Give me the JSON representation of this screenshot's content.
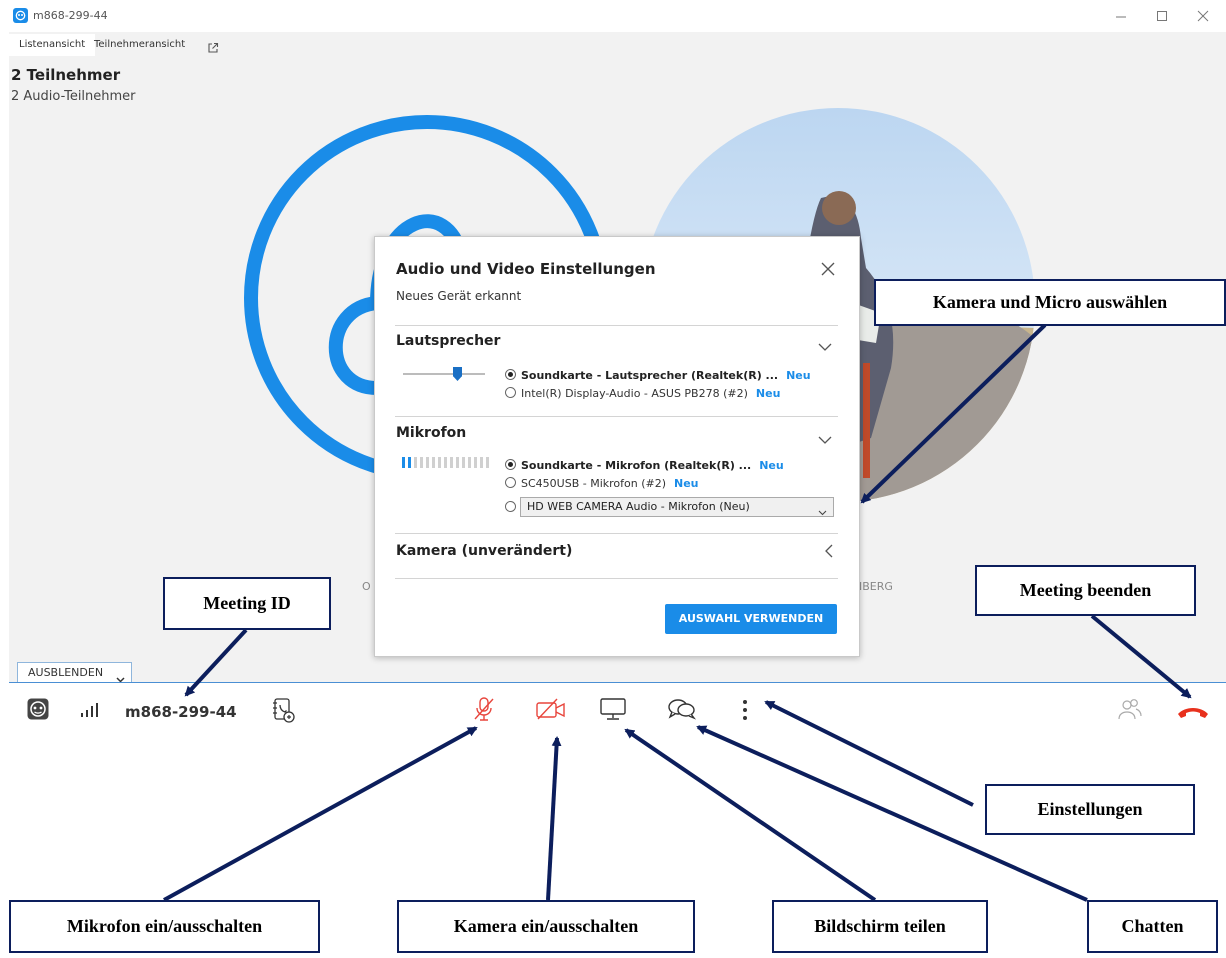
{
  "window": {
    "title": "m868-299-44"
  },
  "tabs": [
    {
      "label": "Listenansicht"
    },
    {
      "label": "Teilnehmeransicht"
    }
  ],
  "participants": {
    "count_label": "2 Teilnehmer",
    "audio_label": "2 Audio-Teilnehmer"
  },
  "names": {
    "left": "O",
    "right": "NBERG"
  },
  "dialog": {
    "title": "Audio und Video Einstellungen",
    "subtitle": "Neues Gerät erkannt",
    "speaker": {
      "title": "Lautsprecher",
      "options": [
        {
          "label": "Soundkarte - Lautsprecher (Realtek(R) ...",
          "badge": "Neu",
          "selected": true
        },
        {
          "label": "Intel(R) Display-Audio - ASUS PB278  (#2)",
          "badge": "Neu",
          "selected": false
        }
      ]
    },
    "mic": {
      "title": "Mikrofon",
      "options": [
        {
          "label": "Soundkarte - Mikrofon (Realtek(R) ...",
          "badge": "Neu",
          "selected": true
        },
        {
          "label": "SC450USB - Mikrofon  (#2)",
          "badge": "Neu",
          "selected": false
        }
      ],
      "select_value": "HD WEB CAMERA Audio - Mikrofon (Neu)"
    },
    "camera": {
      "title": "Kamera (unverändert)"
    },
    "apply_label": "AUSWAHL VERWENDEN"
  },
  "hide_label": "AUSBLENDEN",
  "toolbar": {
    "meeting_id": "m868-299-44"
  },
  "callouts": {
    "camera_mic": "Kamera und Micro auswählen",
    "meeting_id": "Meeting ID",
    "end_meeting": "Meeting beenden",
    "settings": "Einstellungen",
    "mic_toggle": "Mikrofon ein/ausschalten",
    "camera_toggle": "Kamera ein/ausschalten",
    "share_screen": "Bildschirm teilen",
    "chat": "Chatten"
  },
  "colors": {
    "accent": "#1a8ce8",
    "muted_red": "#e8453c",
    "hangup": "#e8311d",
    "callout_border": "#0c1e5c"
  },
  "icons": [
    "app-logo-icon",
    "minimize-icon",
    "maximize-icon",
    "close-icon",
    "popout-icon",
    "avatar-icon",
    "signal-icon",
    "phone-book-icon",
    "mic-off-icon",
    "camera-off-icon",
    "share-screen-icon",
    "chat-icon",
    "more-icon",
    "participants-icon",
    "hangup-icon"
  ]
}
